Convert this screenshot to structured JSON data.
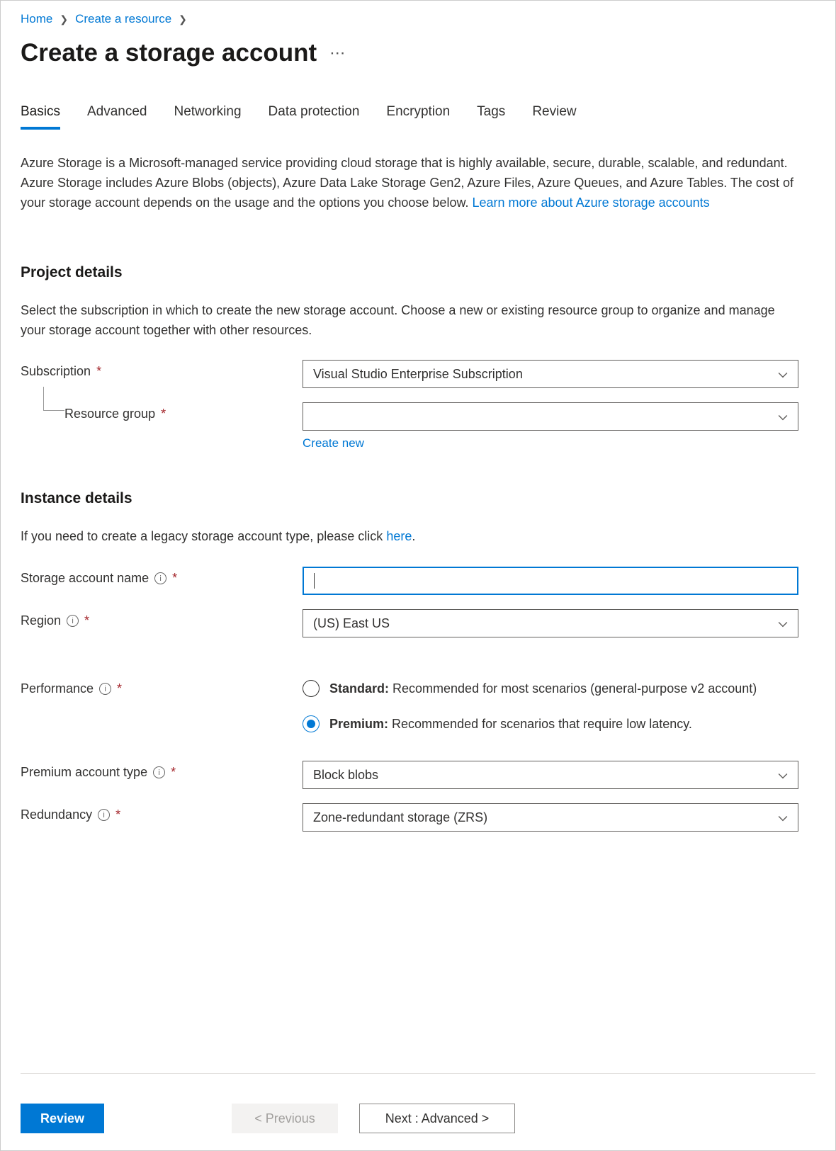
{
  "breadcrumb": {
    "home": "Home",
    "create_resource": "Create a resource"
  },
  "title": "Create a storage account",
  "tabs": [
    "Basics",
    "Advanced",
    "Networking",
    "Data protection",
    "Encryption",
    "Tags",
    "Review"
  ],
  "active_tab": 0,
  "intro": {
    "text": "Azure Storage is a Microsoft-managed service providing cloud storage that is highly available, secure, durable, scalable, and redundant. Azure Storage includes Azure Blobs (objects), Azure Data Lake Storage Gen2, Azure Files, Azure Queues, and Azure Tables. The cost of your storage account depends on the usage and the options you choose below. ",
    "link": "Learn more about Azure storage accounts"
  },
  "project": {
    "heading": "Project details",
    "desc": "Select the subscription in which to create the new storage account. Choose a new or existing resource group to organize and manage your storage account together with other resources.",
    "subscription_label": "Subscription",
    "subscription_value": "Visual Studio Enterprise Subscription",
    "rg_label": "Resource group",
    "rg_value": "",
    "create_new": "Create new"
  },
  "instance": {
    "heading": "Instance details",
    "desc_pre": "If you need to create a legacy storage account type, please click ",
    "desc_link": "here",
    "desc_post": ".",
    "name_label": "Storage account name",
    "name_value": "",
    "region_label": "Region",
    "region_value": "(US) East US",
    "perf_label": "Performance",
    "perf_options": [
      {
        "value": "standard",
        "title": "Standard:",
        "desc": " Recommended for most scenarios (general-purpose v2 account)"
      },
      {
        "value": "premium",
        "title": "Premium:",
        "desc": " Recommended for scenarios that require low latency."
      }
    ],
    "perf_selected": "premium",
    "premium_type_label": "Premium account type",
    "premium_type_value": "Block blobs",
    "redundancy_label": "Redundancy",
    "redundancy_value": "Zone-redundant storage (ZRS)"
  },
  "footer": {
    "review": "Review",
    "previous": "< Previous",
    "next": "Next : Advanced >"
  }
}
